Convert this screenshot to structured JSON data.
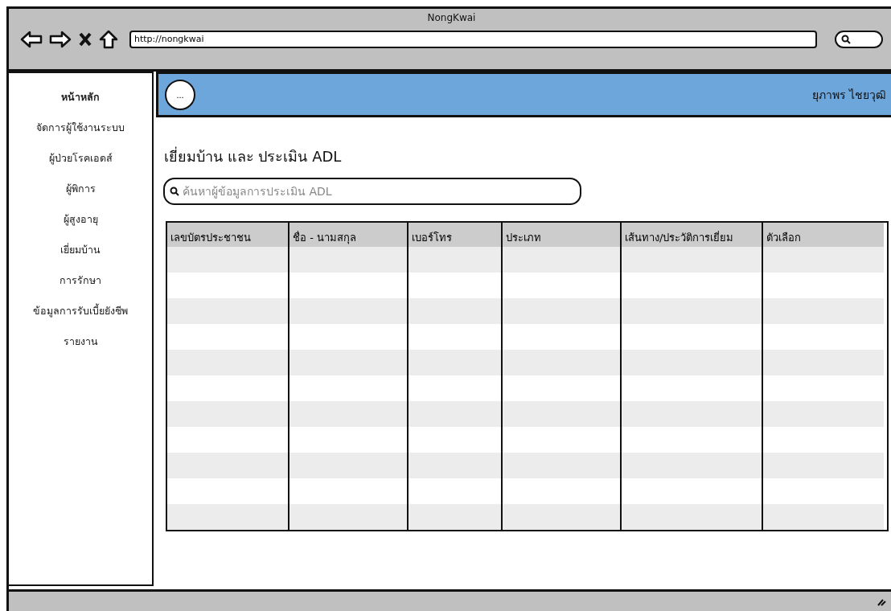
{
  "window": {
    "title": "NongKwai",
    "url": "http://nongkwai"
  },
  "sidebar": {
    "items": [
      {
        "label": "หน้าหลัก",
        "selected": true
      },
      {
        "label": "จัดการผู้ใช้งานระบบ",
        "selected": false
      },
      {
        "label": "ผู้ป่วยโรคเอดส์",
        "selected": false
      },
      {
        "label": "ผู้พิการ",
        "selected": false
      },
      {
        "label": "ผู้สูงอายุ",
        "selected": false
      },
      {
        "label": "เยี่ยมบ้าน",
        "selected": false
      },
      {
        "label": "การรักษา",
        "selected": false
      },
      {
        "label": "ข้อมูลการรับเบี้ยยังชีพ",
        "selected": false
      },
      {
        "label": "รายงาน",
        "selected": false
      }
    ]
  },
  "header": {
    "menu_button": "...",
    "user_name": "ยุภาพร ไชยวุฒิ"
  },
  "page_title": "เยี่ยมบ้าน และ ประเมิน ADL",
  "search": {
    "placeholder": "ค้นหาผู้ข้อมูลการประเมิน ADL"
  },
  "table": {
    "columns": [
      "เลขบัตรประชาชน",
      "ชื่อ - นามสกุล",
      "เบอร์โทร",
      "ประเภท",
      "เส้นทาง/ประวัติการเยี่ยม",
      "ตัวเลือก"
    ]
  }
}
